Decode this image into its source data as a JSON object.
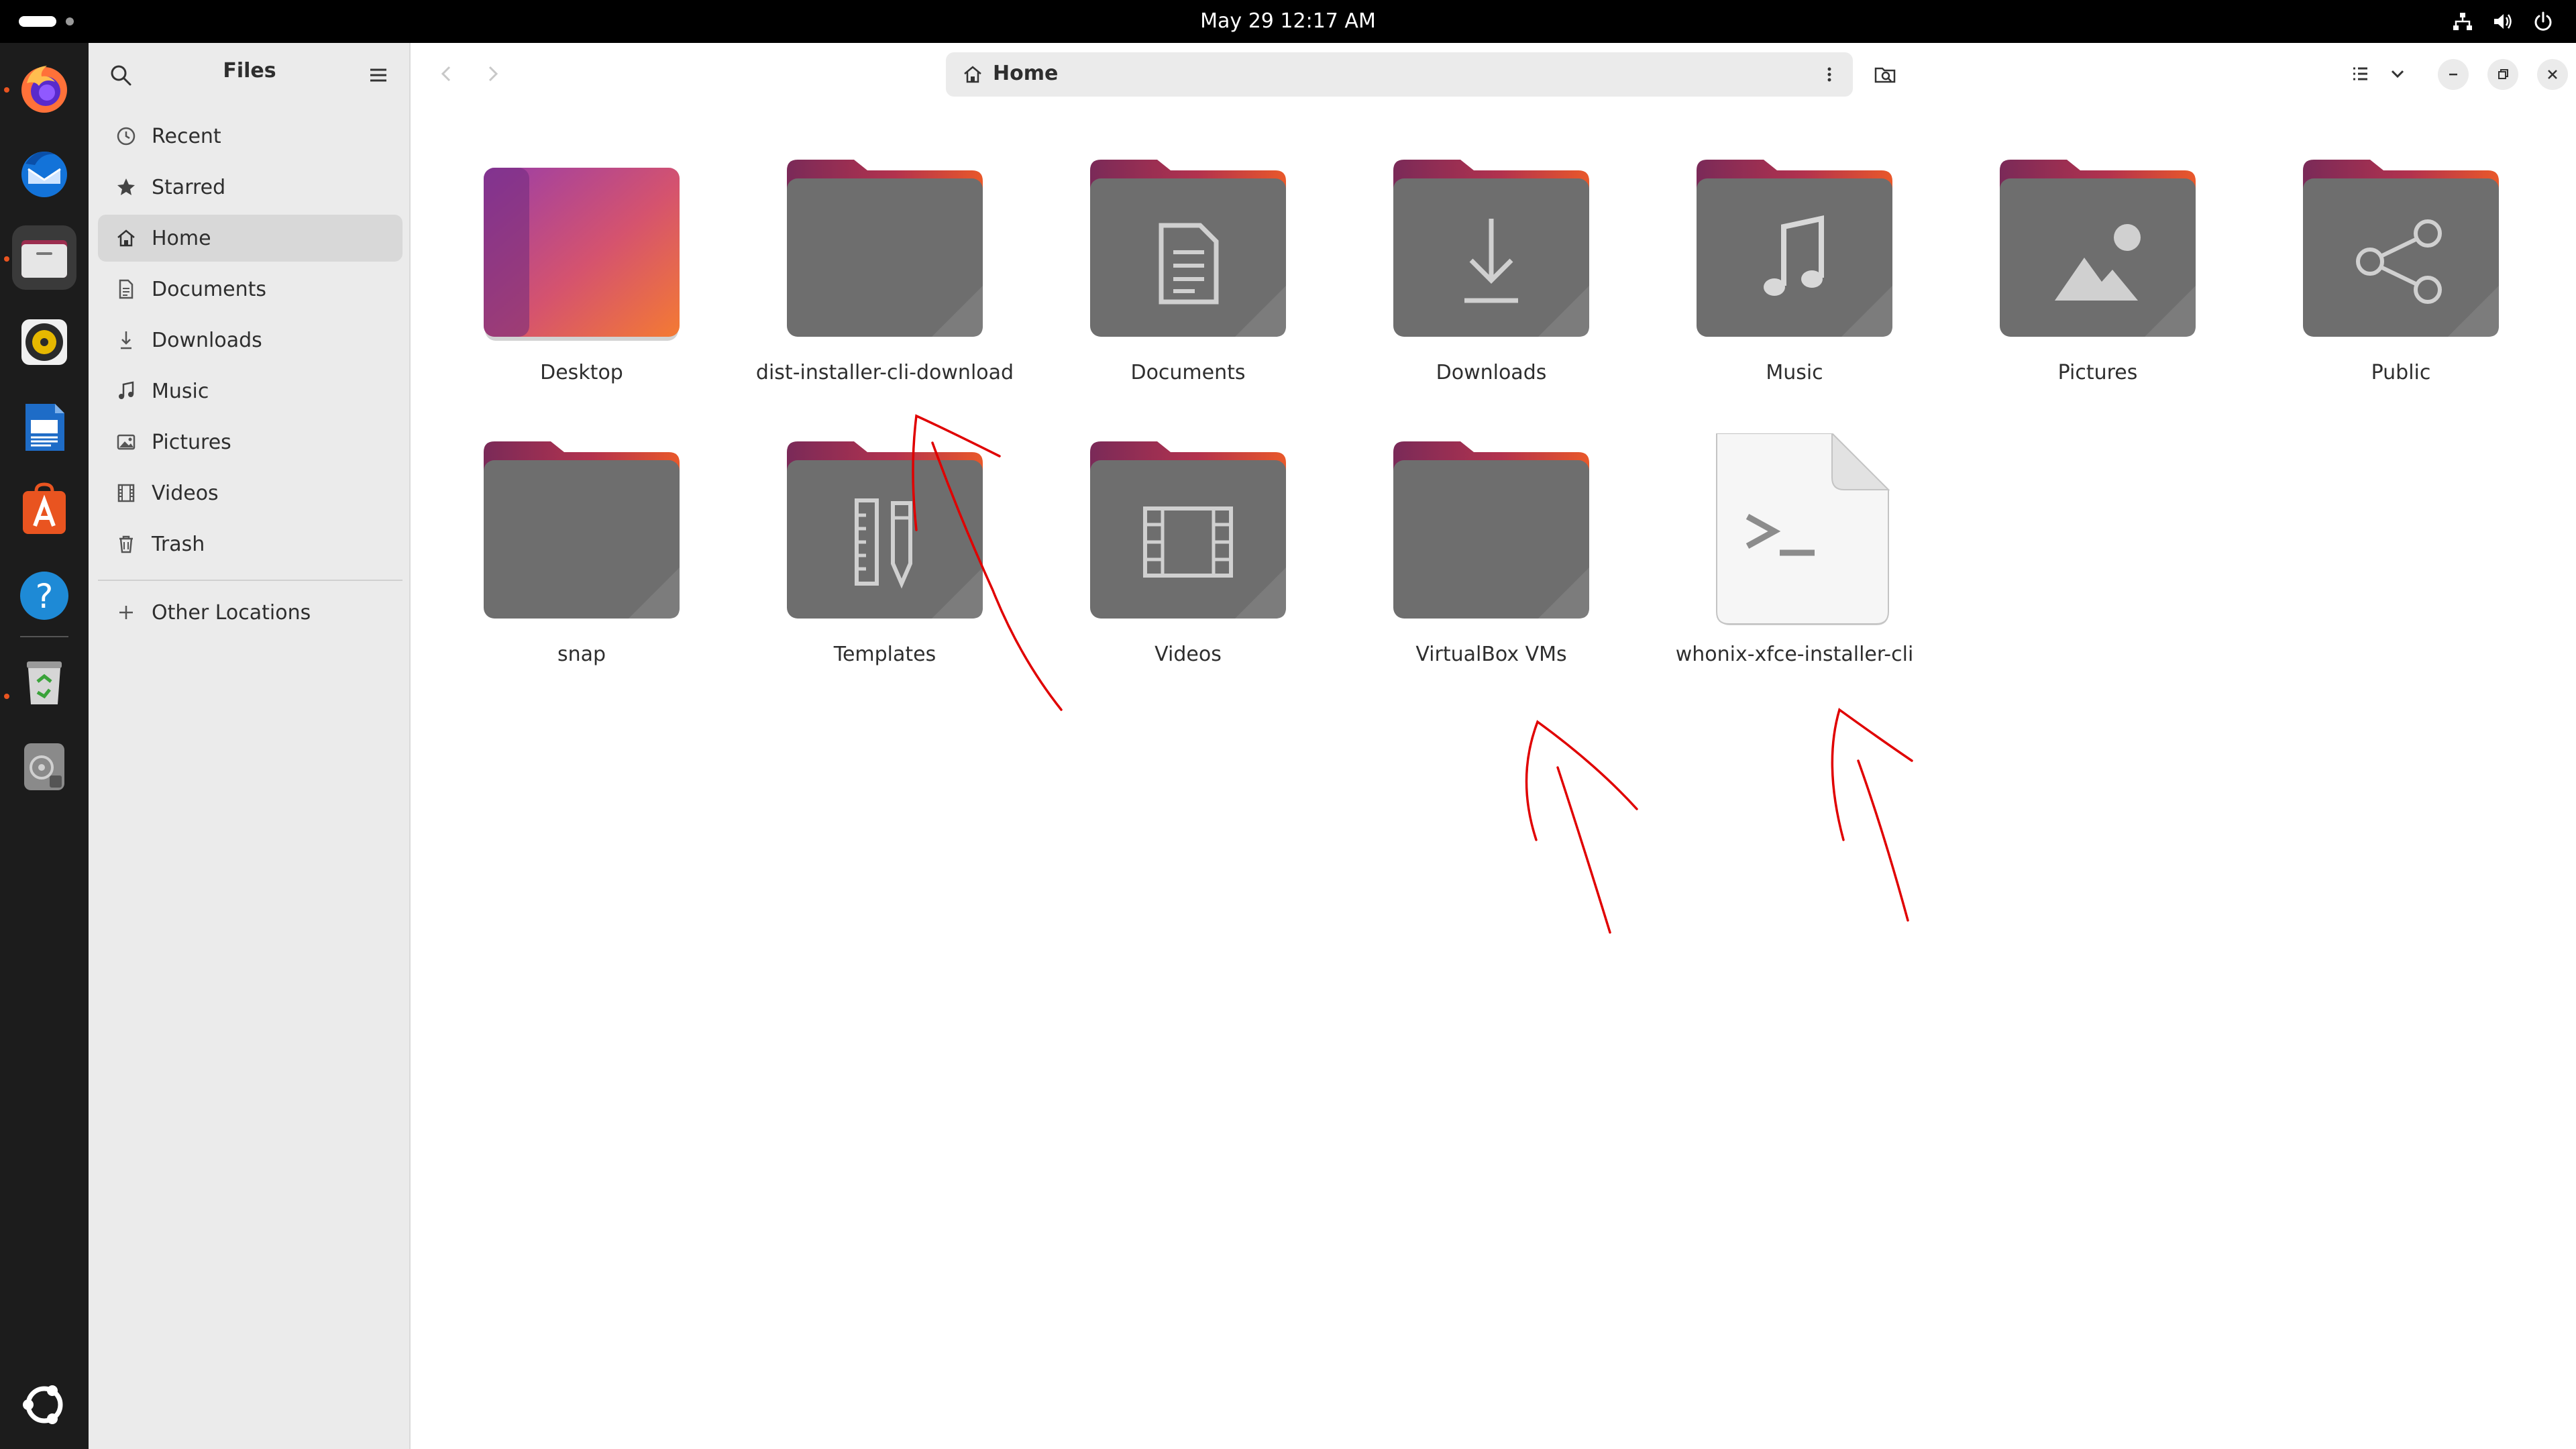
{
  "topbar": {
    "clock": "May 29  12:17 AM",
    "tray_icons": [
      "network-icon",
      "volume-icon",
      "power-icon"
    ]
  },
  "dock": {
    "apps": [
      "firefox",
      "thunderbird",
      "files",
      "rhythmbox",
      "libreoffice-writer",
      "app-center",
      "help",
      "trash",
      "disk"
    ],
    "show_apps_icon": "ubuntu-logo-icon"
  },
  "sidebar": {
    "title": "Files",
    "items": [
      {
        "label": "Recent",
        "icon": "clock-icon"
      },
      {
        "label": "Starred",
        "icon": "star-icon"
      },
      {
        "label": "Home",
        "icon": "home-icon",
        "selected": true
      },
      {
        "label": "Documents",
        "icon": "document-icon"
      },
      {
        "label": "Downloads",
        "icon": "download-icon"
      },
      {
        "label": "Music",
        "icon": "music-icon"
      },
      {
        "label": "Pictures",
        "icon": "picture-icon"
      },
      {
        "label": "Videos",
        "icon": "video-icon"
      },
      {
        "label": "Trash",
        "icon": "trash-icon"
      }
    ],
    "other": {
      "label": "Other Locations",
      "icon": "plus-icon"
    }
  },
  "header": {
    "path": "Home"
  },
  "files": [
    {
      "label": "Desktop",
      "kind": "desktop"
    },
    {
      "label": "dist-installer-cli-download",
      "kind": "folder"
    },
    {
      "label": "Documents",
      "kind": "folder-documents"
    },
    {
      "label": "Downloads",
      "kind": "folder-downloads"
    },
    {
      "label": "Music",
      "kind": "folder-music"
    },
    {
      "label": "Pictures",
      "kind": "folder-pictures"
    },
    {
      "label": "Public",
      "kind": "folder-public"
    },
    {
      "label": "snap",
      "kind": "folder"
    },
    {
      "label": "Templates",
      "kind": "folder-templates"
    },
    {
      "label": "Videos",
      "kind": "folder-videos"
    },
    {
      "label": "VirtualBox VMs",
      "kind": "folder"
    },
    {
      "label": "whonix-xfce-installer-cli",
      "kind": "script"
    }
  ],
  "colors": {
    "folder_body": "#6e6e6e",
    "folder_tab": "#9a2a50",
    "accent": "#e95420",
    "annotation": "#e00000"
  }
}
